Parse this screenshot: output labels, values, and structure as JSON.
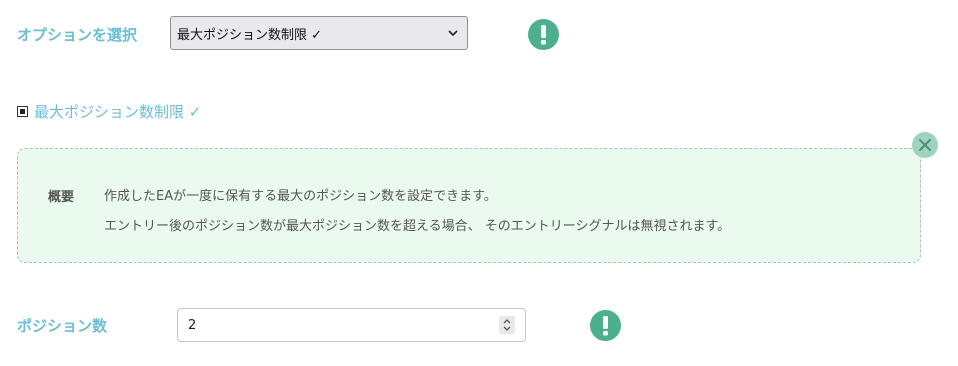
{
  "option_select": {
    "label": "オプションを選択",
    "selected": "最大ポジション数制限 ✓"
  },
  "section": {
    "title": "最大ポジション数制限 ✓"
  },
  "info": {
    "label": "概要",
    "line1": "作成したEAが一度に保有する最大のポジション数を設定できます。",
    "line2": "エントリー後のポジション数が最大ポジション数を超える場合、 そのエントリーシグナルは無視されます。"
  },
  "position_count": {
    "label": "ポジション数",
    "value": "2"
  },
  "colors": {
    "accent_label": "#6dbdd3",
    "alert_icon": "#4caf8e",
    "info_bg": "#eafaee",
    "close_btn": "#9ed4bf"
  }
}
